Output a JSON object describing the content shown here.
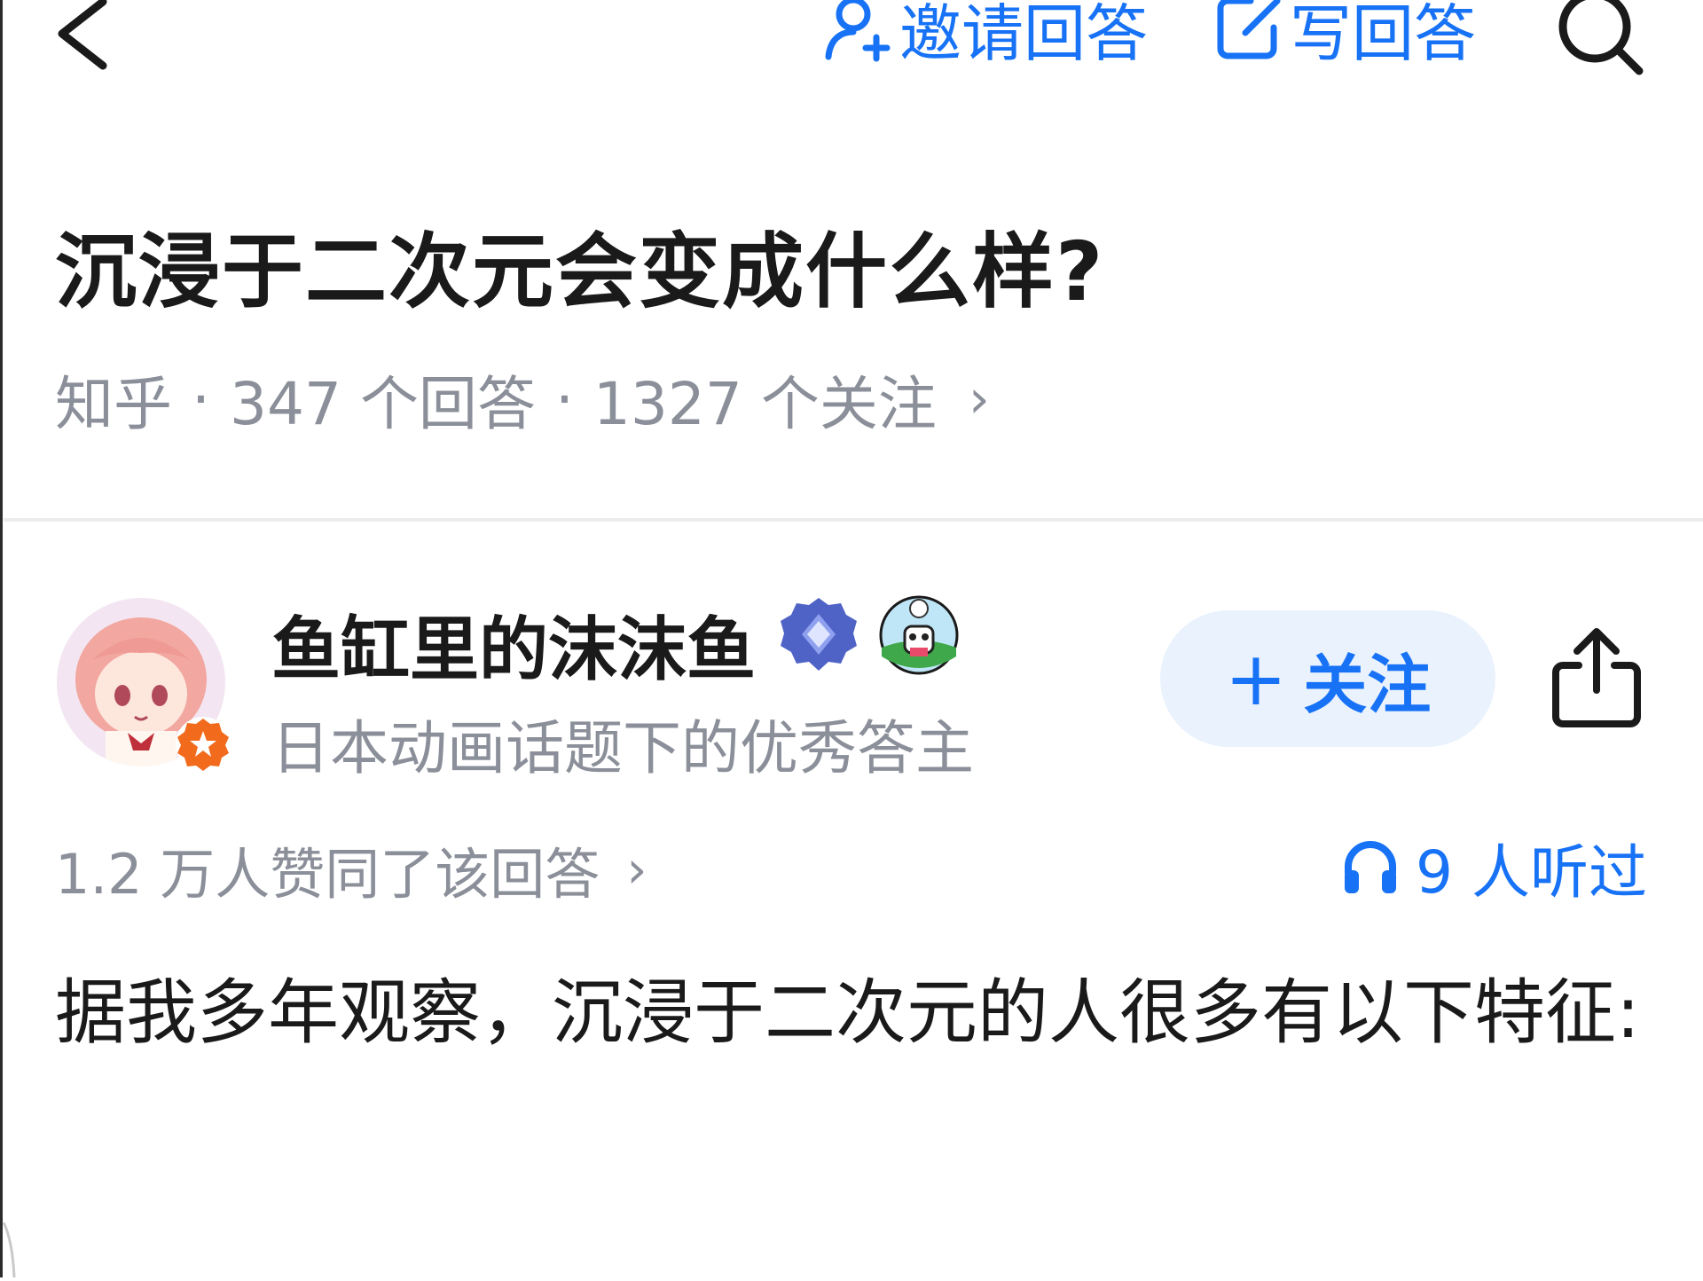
{
  "topbar": {
    "invite_label": "邀请回答",
    "write_label": "写回答"
  },
  "question": {
    "title": "沉浸于二次元会变成什么样?",
    "source": "知乎",
    "answers": "347 个回答",
    "followers": "1327 个关注",
    "separator": "·",
    "chevron": "›"
  },
  "author": {
    "name": "鱼缸里的沫沫鱼",
    "description": "日本动画话题下的优秀答主",
    "follow_label": "关注",
    "follow_plus": "+"
  },
  "answer": {
    "upvotes": "1.2 万人赞同了该回答",
    "listened": "9 人听过",
    "content": "据我多年观察，沉浸于二次元的人很多有以下特征:"
  },
  "colors": {
    "accent": "#1772f6",
    "follow_bg": "#eaf2fe",
    "meta_gray": "#8b8f99",
    "text": "#1a1a1a"
  },
  "icons": [
    "back-icon",
    "invite-icon",
    "write-icon",
    "search-icon",
    "verified-badge-icon",
    "panda-badge-icon",
    "star-badge-icon",
    "share-icon",
    "headphones-icon"
  ]
}
